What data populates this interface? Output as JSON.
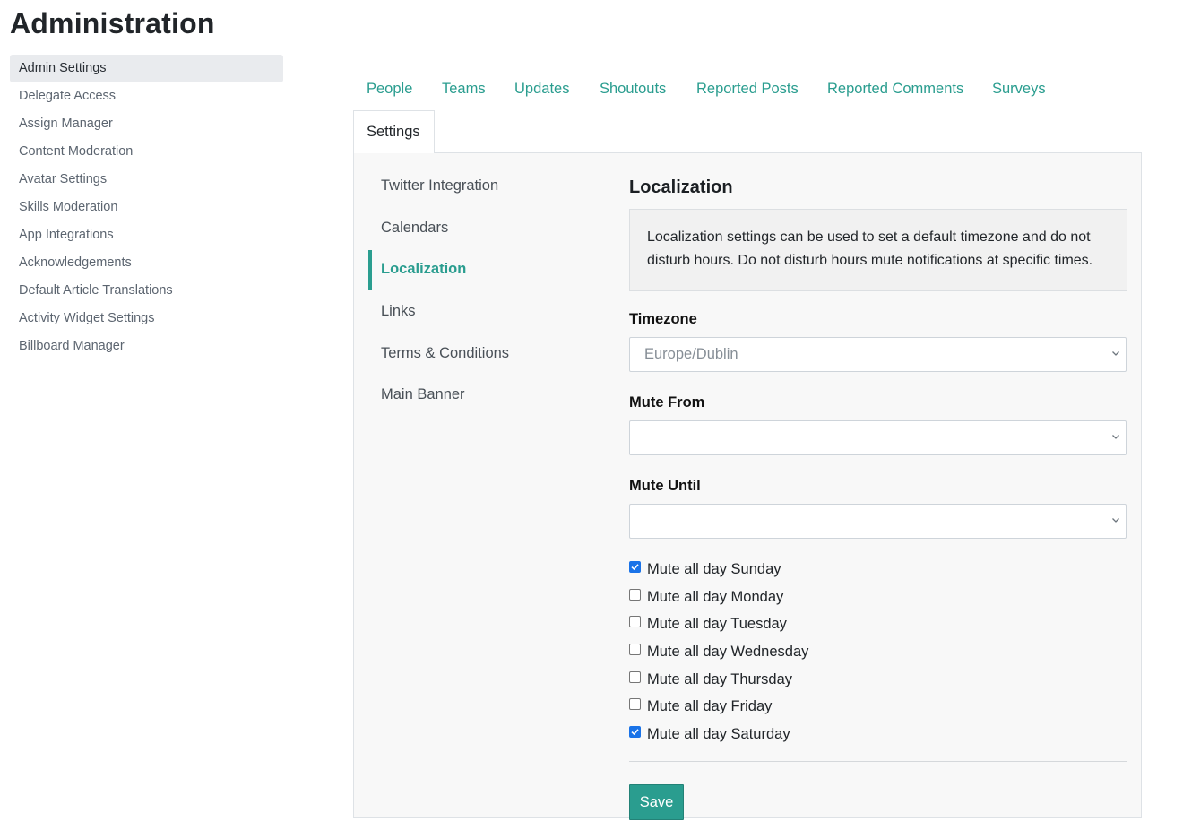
{
  "page": {
    "title": "Administration"
  },
  "sidebar": {
    "items": [
      {
        "label": "Admin Settings",
        "active": true
      },
      {
        "label": "Delegate Access"
      },
      {
        "label": "Assign Manager"
      },
      {
        "label": "Content Moderation"
      },
      {
        "label": "Avatar Settings"
      },
      {
        "label": "Skills Moderation"
      },
      {
        "label": "App Integrations"
      },
      {
        "label": "Acknowledgements"
      },
      {
        "label": "Default Article Translations"
      },
      {
        "label": "Activity Widget Settings"
      },
      {
        "label": "Billboard Manager"
      }
    ]
  },
  "tabs": {
    "items": [
      {
        "label": "People"
      },
      {
        "label": "Teams"
      },
      {
        "label": "Updates"
      },
      {
        "label": "Shoutouts"
      },
      {
        "label": "Reported Posts"
      },
      {
        "label": "Reported Comments"
      },
      {
        "label": "Surveys"
      },
      {
        "label": "Settings",
        "active": true
      }
    ]
  },
  "subnav": {
    "items": [
      {
        "label": "Twitter Integration"
      },
      {
        "label": "Calendars"
      },
      {
        "label": "Localization",
        "active": true
      },
      {
        "label": "Links"
      },
      {
        "label": "Terms & Conditions"
      },
      {
        "label": "Main Banner"
      }
    ]
  },
  "localization": {
    "title": "Localization",
    "info": "Localization settings can be used to set a default timezone and do not disturb hours. Do not disturb hours mute notifications at specific times.",
    "timezone_label": "Timezone",
    "timezone_value": "Europe/Dublin",
    "mute_from_label": "Mute From",
    "mute_from_value": "",
    "mute_until_label": "Mute Until",
    "mute_until_value": "",
    "checkboxes": [
      {
        "label": "Mute all day Sunday",
        "checked": true
      },
      {
        "label": "Mute all day Monday",
        "checked": false
      },
      {
        "label": "Mute all day Tuesday",
        "checked": false
      },
      {
        "label": "Mute all day Wednesday",
        "checked": false
      },
      {
        "label": "Mute all day Thursday",
        "checked": false
      },
      {
        "label": "Mute all day Friday",
        "checked": false
      },
      {
        "label": "Mute all day Saturday",
        "checked": true
      }
    ],
    "save_label": "Save"
  },
  "colors": {
    "accent": "#2a9d8f",
    "checkbox": "#1a73e8"
  },
  "icons": {
    "select_arrow": "chevron-down-icon",
    "checkmark": "checkmark-icon"
  }
}
